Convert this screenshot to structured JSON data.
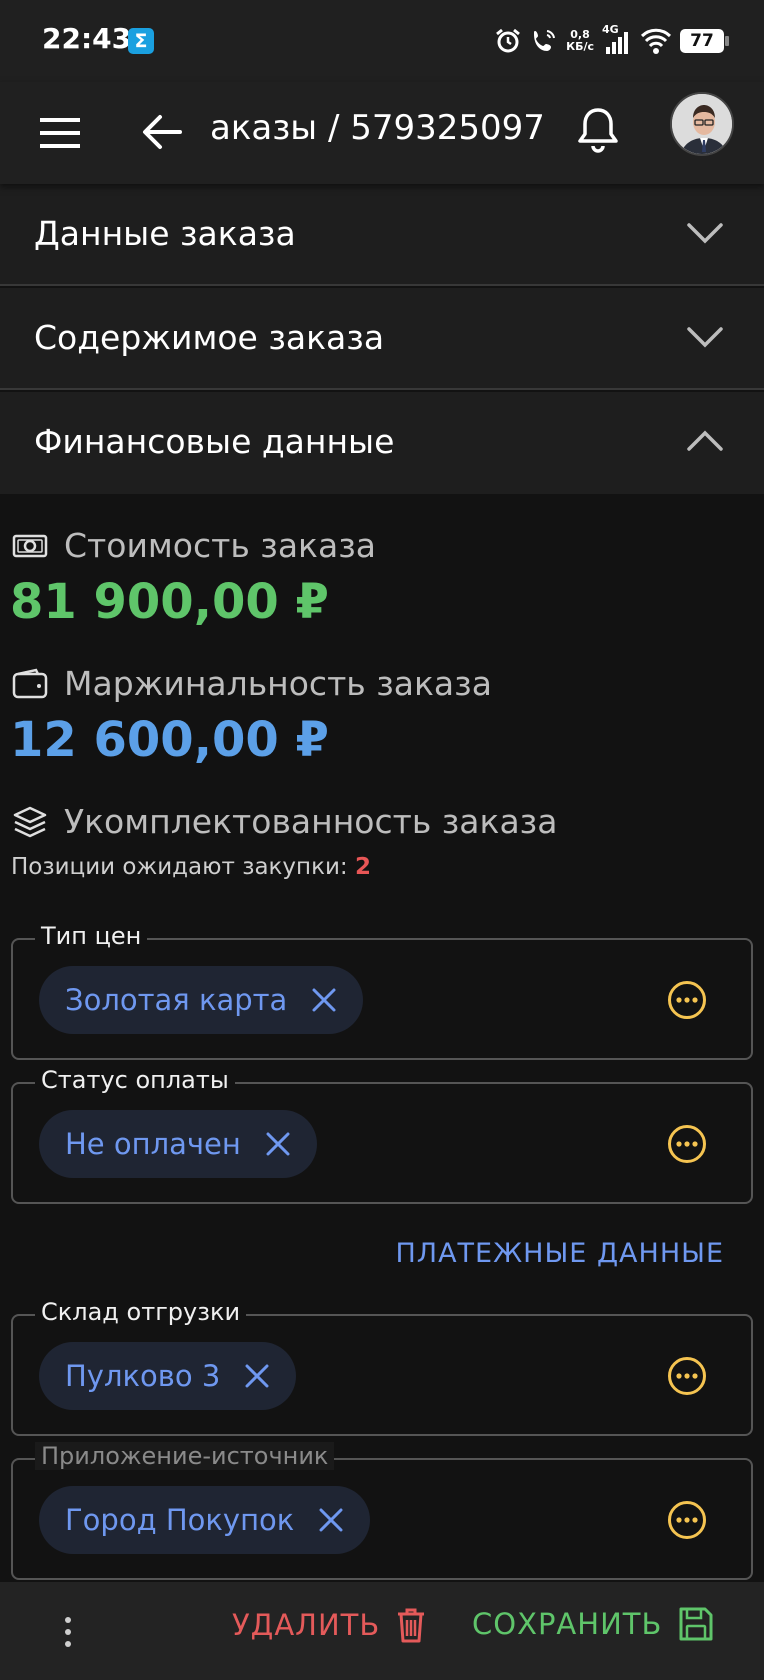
{
  "status_bar": {
    "time": "22:43",
    "app_icon": "Σ",
    "speed_value": "0,8",
    "speed_unit": "КБ/с",
    "network": "4G",
    "battery": "77"
  },
  "header": {
    "title": "аказы / 579325097"
  },
  "accordion": {
    "items": [
      {
        "label": "Данные заказа",
        "expanded": false
      },
      {
        "label": "Содержимое заказа",
        "expanded": false
      },
      {
        "label": "Финансовые данные",
        "expanded": true
      }
    ]
  },
  "finance": {
    "cost_label": "Стоимость заказа",
    "cost_value": "81 900,00 ₽",
    "margin_label": "Маржинальность заказа",
    "margin_value": "12 600,00 ₽",
    "completeness_label": "Укомплектованность заказа",
    "pending_label": "Позиции ожидают закупки:",
    "pending_count": "2"
  },
  "fields": {
    "price_type": {
      "label": "Тип цен",
      "value": "Золотая карта"
    },
    "payment_status": {
      "label": "Статус оплаты",
      "value": "Не оплачен"
    },
    "payment_link": "ПЛАТЕЖНЫЕ ДАННЫЕ",
    "warehouse": {
      "label": "Склад отгрузки",
      "value": "Пулково 3"
    },
    "source_app": {
      "label": "Приложение-источник",
      "value": "Город Покупок"
    }
  },
  "bottom_bar": {
    "delete_label": "УДАЛИТЬ",
    "save_label": "СОХРАНИТЬ"
  },
  "colors": {
    "background": "#121212",
    "cost": "#5fc56a",
    "margin": "#5ca0e8",
    "chip_text": "#6f98f0",
    "more_icon": "#f5c451",
    "delete": "#e45a5a",
    "save": "#5fc56a"
  }
}
